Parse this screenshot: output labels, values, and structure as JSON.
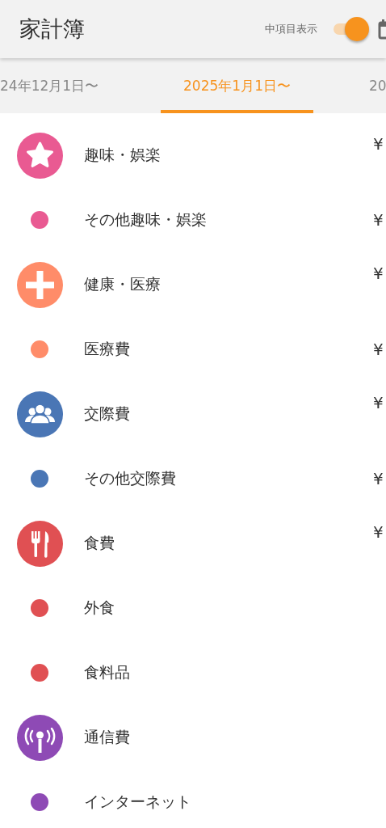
{
  "header": {
    "title": "家計簿",
    "toggle": {
      "label": "中項目表示",
      "on": true
    }
  },
  "period_tabs": [
    {
      "label": "24年12月1日〜",
      "selected": false
    },
    {
      "label": "2025年1月1日〜",
      "selected": true
    },
    {
      "label": "20",
      "selected": false
    }
  ],
  "categories": [
    {
      "kind": "category",
      "label": "趣味・娯楽",
      "amount": "¥",
      "color": "#e95a92"
    },
    {
      "kind": "subcategory",
      "label": "その他趣味・娯楽",
      "amount": "¥",
      "color": "#e95a92"
    },
    {
      "kind": "category",
      "label": "健康・医療",
      "amount": "¥",
      "color": "#ff8c69"
    },
    {
      "kind": "subcategory",
      "label": "医療費",
      "amount": "¥",
      "color": "#ff8c69"
    },
    {
      "kind": "category",
      "label": "交際費",
      "amount": "¥",
      "color": "#4a76b5"
    },
    {
      "kind": "subcategory",
      "label": "その他交際費",
      "amount": "¥",
      "color": "#4a76b5"
    },
    {
      "kind": "category",
      "label": "食費",
      "amount": "¥",
      "color": "#e05053"
    },
    {
      "kind": "subcategory",
      "label": "外食",
      "color": "#e05053"
    },
    {
      "kind": "subcategory",
      "label": "食料品",
      "color": "#e05053"
    },
    {
      "kind": "category",
      "label": "通信費",
      "color": "#8e4ab5"
    },
    {
      "kind": "subcategory",
      "label": "インターネット",
      "color": "#8e4ab5"
    }
  ]
}
